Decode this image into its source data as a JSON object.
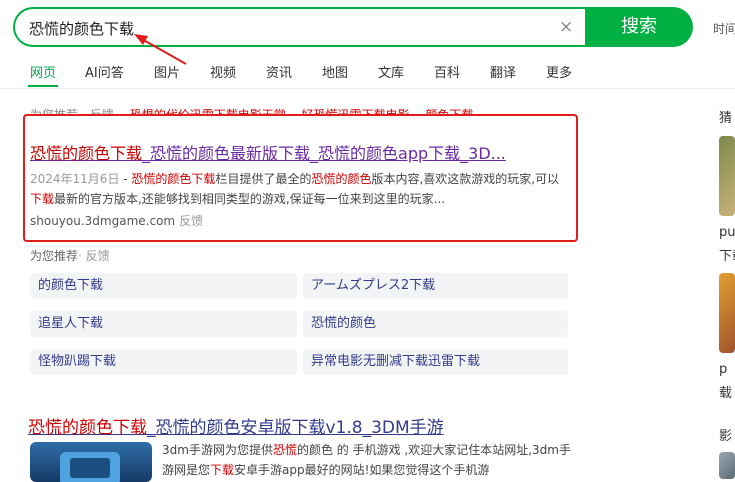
{
  "search": {
    "query": "恐慌的颜色下载",
    "button_label": "搜索",
    "clear_glyph": "×",
    "time_filter": "时间"
  },
  "nav": {
    "items": [
      "网页",
      "AI问答",
      "图片",
      "视频",
      "资讯",
      "地图",
      "文库",
      "百科",
      "翻译",
      "更多"
    ],
    "active_index": 0
  },
  "rec_top": {
    "label": "为您推荐",
    "feedback": "反馈",
    "links": [
      "恐惧的代价迅雷下载电影天堂",
      "好恐慌迅雷下载电影",
      "颜色下载"
    ]
  },
  "result1": {
    "title_hl1": "恐慌的颜色下载",
    "title_rest": "_恐慌的颜色最新版下载_恐慌的颜色app下载_3D...",
    "date": "2024年11月6日",
    "desc_sep": " - ",
    "desc_hl1": "恐慌的颜色下载",
    "desc_p1": "栏目提供了最全的",
    "desc_hl2": "恐慌的颜色",
    "desc_p2": "版本内容,喜欢这款游戏的玩家,可以",
    "desc_hl3": "下载",
    "desc_p3": "最新的官方版本,还能够找到相同类型的游戏,保证每一位来到这里的玩家...",
    "source": "shouyou.3dmgame.com",
    "feedback": "反馈"
  },
  "rec": {
    "label": "为您推荐",
    "feedback": "· 反馈",
    "chips": [
      "的颜色下载",
      "アームズプレス2下载",
      "追星人下载",
      "恐慌的颜色",
      "怪物趴踢下载",
      "异常电影无删减下载迅雷下载"
    ]
  },
  "result2": {
    "title_hl": "恐慌的颜色下载",
    "title_rest": "_恐慌的颜色安卓版下载v1.8_3DM手游",
    "desc_p1": "3dm手游网为您提供",
    "desc_hl1": "恐慌",
    "desc_p2": "的颜色 的 手机游戏 ,欢迎大家记住本站网址,3dm手游网是您",
    "desc_hl2": "下载",
    "desc_p3": "安卓手游app最好的网站!如果您觉得这个手机游"
  },
  "sidebar": {
    "title": "猜",
    "text1": "pu",
    "text2": "下载",
    "text3": "p",
    "text4": "载",
    "text5": "影"
  },
  "colors": {
    "brand_green": "#00b043",
    "highlight_red": "#c00",
    "link_purple": "#6a2aa6",
    "link_blue": "#333a8c",
    "annotation_red": "#e21b1b"
  }
}
